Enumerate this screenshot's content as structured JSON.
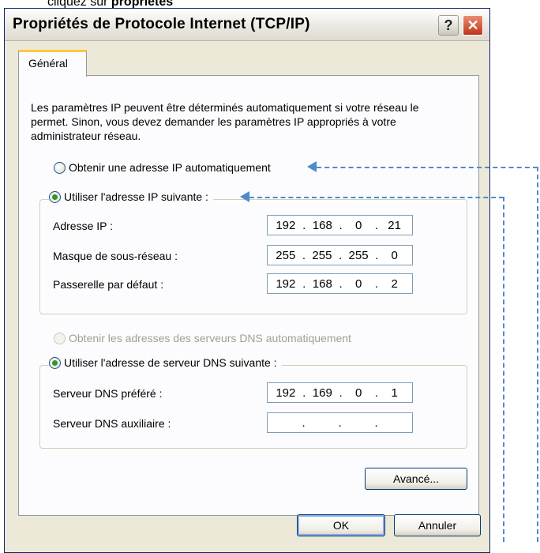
{
  "caption": {
    "prefix": "cliquez sur ",
    "bold": "propriétés"
  },
  "window": {
    "title": "Propriétés de Protocole Internet (TCP/IP)",
    "help_label": "?",
    "close_label": "✕"
  },
  "tab": {
    "label": "Général"
  },
  "description": "Les paramètres IP peuvent être déterminés automatiquement si votre réseau le permet. Sinon, vous devez demander les paramètres IP appropriés à votre administrateur réseau.",
  "ip_options": {
    "auto_label": "Obtenir une adresse IP automatiquement",
    "manual_label": "Utiliser l'adresse IP suivante :"
  },
  "ip_fields": [
    {
      "label": "Adresse IP :",
      "value": [
        "192",
        "168",
        "0",
        "21"
      ]
    },
    {
      "label": "Masque de sous-réseau :",
      "value": [
        "255",
        "255",
        "255",
        "0"
      ]
    },
    {
      "label": "Passerelle par défaut :",
      "value": [
        "192",
        "168",
        "0",
        "2"
      ]
    }
  ],
  "dns_options": {
    "auto_label": "Obtenir les adresses des serveurs DNS automatiquement",
    "manual_label": "Utiliser l'adresse de serveur DNS suivante :"
  },
  "dns_fields": [
    {
      "label": "Serveur DNS préféré :",
      "value": [
        "192",
        "169",
        "0",
        "1"
      ]
    },
    {
      "label": "Serveur DNS auxiliaire :",
      "value": [
        "",
        "",
        "",
        ""
      ]
    }
  ],
  "buttons": {
    "advanced": "Avancé...",
    "ok": "OK",
    "cancel": "Annuler"
  },
  "colors": {
    "accent_arrow": "#4f8bc9",
    "radio_checked": "#2b9a23",
    "tab_highlight": "#ffc83c"
  }
}
